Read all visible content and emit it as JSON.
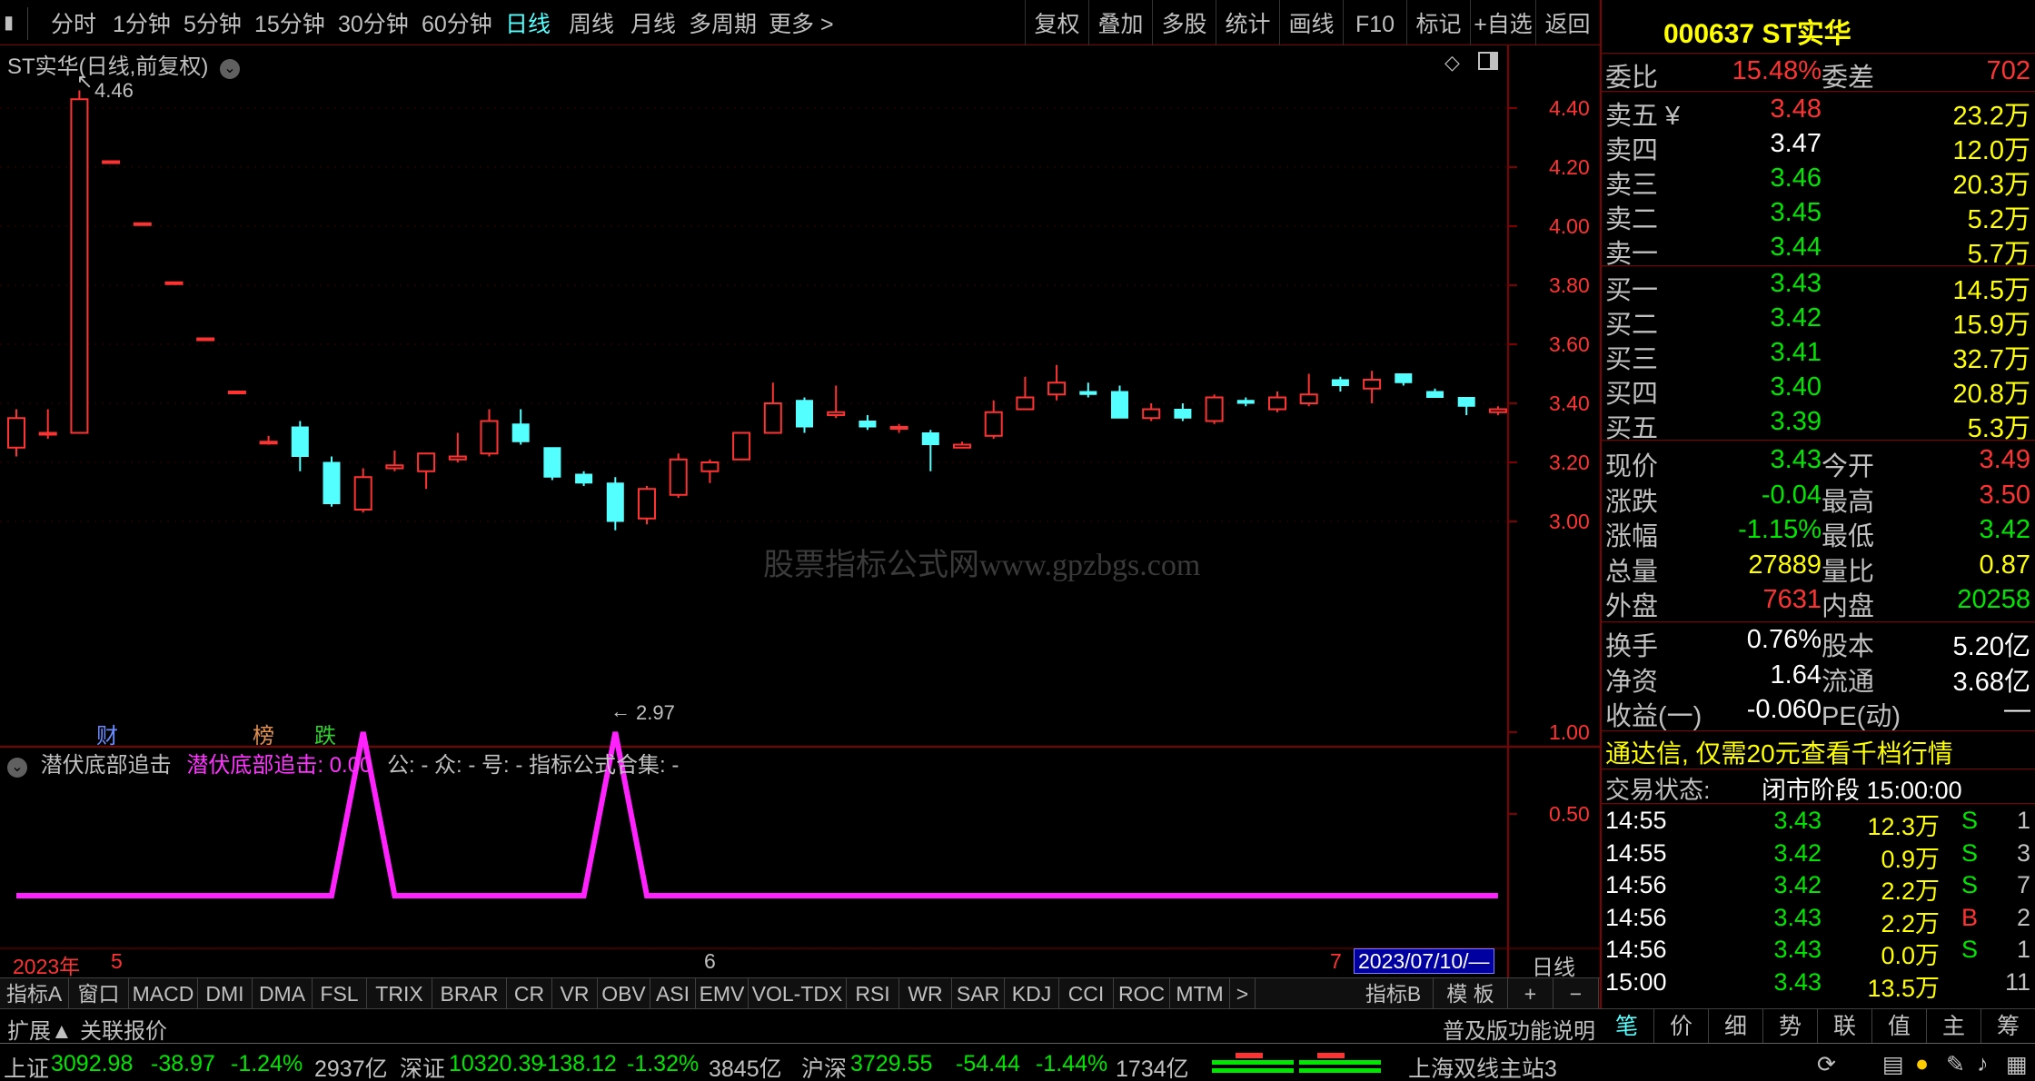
{
  "toolbar": {
    "periods": [
      "分时",
      "1分钟",
      "5分钟",
      "15分钟",
      "30分钟",
      "60分钟",
      "日线",
      "周线",
      "月线",
      "多周期",
      "更多 >"
    ],
    "active_period": "日线",
    "actions": [
      "复权",
      "叠加",
      "多股",
      "统计",
      "画线",
      "F10",
      "标记",
      "+自选",
      "返回"
    ]
  },
  "chart": {
    "title": "ST实华(日线,前复权)",
    "high_label": "4.46",
    "low_label": "2.97",
    "watermark": "股票指标公式网www.gpzbgs.com",
    "y_ticks": [
      "4.40",
      "4.20",
      "4.00",
      "3.80",
      "3.60",
      "3.40",
      "3.20",
      "3.00"
    ],
    "badges": [
      {
        "text": "财",
        "color": "#2a5cff"
      },
      {
        "text": "榜",
        "color": "#d07030"
      },
      {
        "text": "跌",
        "color": "#00c000"
      }
    ],
    "x_labels": {
      "year": "2023年",
      "m5": "5",
      "m6": "6",
      "m7": "7",
      "cursor_date": "2023/07/10/—",
      "period": "日线"
    }
  },
  "indicator": {
    "name": "潜伏底部追击",
    "value_label": "潜伏底部追击: 0.00",
    "extra": "公: -  众: -  号: -  指标公式合集: -",
    "y_ticks": [
      "1.00",
      "0.50"
    ]
  },
  "chart_data": [
    {
      "type": "candlestick",
      "title": "ST实华(日线,前复权)",
      "ylim": [
        2.9,
        4.6
      ],
      "candles": [
        {
          "o": 3.25,
          "h": 3.38,
          "l": 3.22,
          "c": 3.35
        },
        {
          "o": 3.3,
          "h": 3.38,
          "l": 3.28,
          "c": 3.3
        },
        {
          "o": 3.3,
          "h": 4.46,
          "l": 3.3,
          "c": 4.43
        },
        {
          "o": 4.22,
          "h": 4.22,
          "l": 4.22,
          "c": 4.22
        },
        {
          "o": 4.01,
          "h": 4.01,
          "l": 4.01,
          "c": 4.01
        },
        {
          "o": 3.81,
          "h": 3.81,
          "l": 3.81,
          "c": 3.81
        },
        {
          "o": 3.62,
          "h": 3.62,
          "l": 3.62,
          "c": 3.62
        },
        {
          "o": 3.44,
          "h": 3.44,
          "l": 3.44,
          "c": 3.44
        },
        {
          "o": 3.27,
          "h": 3.29,
          "l": 3.26,
          "c": 3.27
        },
        {
          "o": 3.32,
          "h": 3.34,
          "l": 3.17,
          "c": 3.22
        },
        {
          "o": 3.2,
          "h": 3.22,
          "l": 3.05,
          "c": 3.06
        },
        {
          "o": 3.04,
          "h": 3.18,
          "l": 3.03,
          "c": 3.15
        },
        {
          "o": 3.18,
          "h": 3.24,
          "l": 3.17,
          "c": 3.19
        },
        {
          "o": 3.17,
          "h": 3.23,
          "l": 3.11,
          "c": 3.23
        },
        {
          "o": 3.21,
          "h": 3.3,
          "l": 3.2,
          "c": 3.22
        },
        {
          "o": 3.23,
          "h": 3.38,
          "l": 3.22,
          "c": 3.34
        },
        {
          "o": 3.33,
          "h": 3.38,
          "l": 3.26,
          "c": 3.27
        },
        {
          "o": 3.25,
          "h": 3.25,
          "l": 3.14,
          "c": 3.15
        },
        {
          "o": 3.16,
          "h": 3.17,
          "l": 3.12,
          "c": 3.13
        },
        {
          "o": 3.13,
          "h": 3.15,
          "l": 2.97,
          "c": 3.0
        },
        {
          "o": 3.01,
          "h": 3.12,
          "l": 2.99,
          "c": 3.11
        },
        {
          "o": 3.09,
          "h": 3.23,
          "l": 3.08,
          "c": 3.21
        },
        {
          "o": 3.17,
          "h": 3.21,
          "l": 3.13,
          "c": 3.2
        },
        {
          "o": 3.21,
          "h": 3.3,
          "l": 3.21,
          "c": 3.3
        },
        {
          "o": 3.3,
          "h": 3.47,
          "l": 3.3,
          "c": 3.4
        },
        {
          "o": 3.41,
          "h": 3.42,
          "l": 3.3,
          "c": 3.32
        },
        {
          "o": 3.36,
          "h": 3.46,
          "l": 3.35,
          "c": 3.37
        },
        {
          "o": 3.34,
          "h": 3.36,
          "l": 3.31,
          "c": 3.32
        },
        {
          "o": 3.32,
          "h": 3.33,
          "l": 3.3,
          "c": 3.32
        },
        {
          "o": 3.3,
          "h": 3.31,
          "l": 3.17,
          "c": 3.26
        },
        {
          "o": 3.25,
          "h": 3.27,
          "l": 3.25,
          "c": 3.26
        },
        {
          "o": 3.29,
          "h": 3.41,
          "l": 3.28,
          "c": 3.37
        },
        {
          "o": 3.38,
          "h": 3.49,
          "l": 3.38,
          "c": 3.42
        },
        {
          "o": 3.43,
          "h": 3.53,
          "l": 3.41,
          "c": 3.47
        },
        {
          "o": 3.44,
          "h": 3.47,
          "l": 3.42,
          "c": 3.43
        },
        {
          "o": 3.44,
          "h": 3.46,
          "l": 3.35,
          "c": 3.35
        },
        {
          "o": 3.35,
          "h": 3.4,
          "l": 3.34,
          "c": 3.38
        },
        {
          "o": 3.38,
          "h": 3.4,
          "l": 3.34,
          "c": 3.35
        },
        {
          "o": 3.34,
          "h": 3.43,
          "l": 3.33,
          "c": 3.42
        },
        {
          "o": 3.41,
          "h": 3.42,
          "l": 3.39,
          "c": 3.4
        },
        {
          "o": 3.38,
          "h": 3.44,
          "l": 3.37,
          "c": 3.42
        },
        {
          "o": 3.4,
          "h": 3.5,
          "l": 3.39,
          "c": 3.43
        },
        {
          "o": 3.48,
          "h": 3.49,
          "l": 3.44,
          "c": 3.46
        },
        {
          "o": 3.45,
          "h": 3.51,
          "l": 3.4,
          "c": 3.48
        },
        {
          "o": 3.5,
          "h": 3.5,
          "l": 3.46,
          "c": 3.47
        },
        {
          "o": 3.44,
          "h": 3.45,
          "l": 3.42,
          "c": 3.42
        },
        {
          "o": 3.42,
          "h": 3.42,
          "l": 3.36,
          "c": 3.39
        },
        {
          "o": 3.37,
          "h": 3.39,
          "l": 3.36,
          "c": 3.38
        }
      ]
    },
    {
      "type": "line",
      "title": "潜伏底部追击",
      "ylim": [
        0,
        1.2
      ],
      "series": [
        {
          "name": "潜伏底部追击",
          "values": [
            0,
            0,
            0,
            0,
            0,
            0,
            0,
            0,
            0,
            0,
            0,
            1,
            0,
            0,
            0,
            0,
            0,
            0,
            0,
            1,
            0,
            0,
            0,
            0,
            0,
            0,
            0,
            0,
            0,
            0,
            0,
            0,
            0,
            0,
            0,
            0,
            0,
            0,
            0,
            0,
            0,
            0,
            0,
            0,
            0,
            0,
            0,
            0
          ]
        }
      ]
    }
  ],
  "quote": {
    "code_name": "000637 ST实华",
    "weibi_label": "委比",
    "weibi_value": "15.48%",
    "weicha_label": "委差",
    "weicha_value": "702",
    "sell": [
      {
        "label": "卖五",
        "mark": "¥",
        "price": "3.48",
        "vol": "23.2万",
        "color": "#ff3232"
      },
      {
        "label": "卖四",
        "mark": "",
        "price": "3.47",
        "vol": "12.0万",
        "color": "#ffffff"
      },
      {
        "label": "卖三",
        "mark": "",
        "price": "3.46",
        "vol": "20.3万",
        "color": "#00e600"
      },
      {
        "label": "卖二",
        "mark": "",
        "price": "3.45",
        "vol": "5.2万",
        "color": "#00e600"
      },
      {
        "label": "卖一",
        "mark": "",
        "price": "3.44",
        "vol": "5.7万",
        "color": "#00e600"
      }
    ],
    "buy": [
      {
        "label": "买一",
        "price": "3.43",
        "vol": "14.5万"
      },
      {
        "label": "买二",
        "price": "3.42",
        "vol": "15.9万"
      },
      {
        "label": "买三",
        "price": "3.41",
        "vol": "32.7万"
      },
      {
        "label": "买四",
        "price": "3.40",
        "vol": "20.8万"
      },
      {
        "label": "买五",
        "price": "3.39",
        "vol": "5.3万"
      }
    ],
    "stats": [
      {
        "l1": "现价",
        "v1": "3.43",
        "c1": "#00e600",
        "l2": "今开",
        "v2": "3.49",
        "c2": "#ff3232"
      },
      {
        "l1": "涨跌",
        "v1": "-0.04",
        "c1": "#00e600",
        "l2": "最高",
        "v2": "3.50",
        "c2": "#ff3232"
      },
      {
        "l1": "涨幅",
        "v1": "-1.15%",
        "c1": "#00e600",
        "l2": "最低",
        "v2": "3.42",
        "c2": "#00e600"
      },
      {
        "l1": "总量",
        "v1": "27889",
        "c1": "#ffff00",
        "l2": "量比",
        "v2": "0.87",
        "c2": "#ffff00"
      },
      {
        "l1": "外盘",
        "v1": "7631",
        "c1": "#ff3232",
        "l2": "内盘",
        "v2": "20258",
        "c2": "#00e600"
      }
    ],
    "stats2": [
      {
        "l1": "换手",
        "v1": "0.76%",
        "l2": "股本",
        "v2": "5.20亿"
      },
      {
        "l1": "净资",
        "v1": "1.64",
        "l2": "流通",
        "v2": "3.68亿"
      },
      {
        "l1": "收益(一)",
        "v1": "-0.060",
        "l2": "PE(动)",
        "v2": "—"
      }
    ],
    "ad": "通达信, 仅需20元查看千档行情",
    "trade_status_label": "交易状态:",
    "trade_status": "闭市阶段 15:00:00",
    "ticks": [
      {
        "time": "14:55",
        "price": "3.43",
        "vol": "12.3万",
        "bs": "S",
        "n": "1"
      },
      {
        "time": "14:55",
        "price": "3.42",
        "vol": "0.9万",
        "bs": "S",
        "n": "3"
      },
      {
        "time": "14:56",
        "price": "3.42",
        "vol": "2.2万",
        "bs": "S",
        "n": "7"
      },
      {
        "time": "14:56",
        "price": "3.43",
        "vol": "2.2万",
        "bs": "B",
        "n": "2"
      },
      {
        "time": "14:56",
        "price": "3.43",
        "vol": "0.0万",
        "bs": "S",
        "n": "1"
      },
      {
        "time": "15:00",
        "price": "3.43",
        "vol": "13.5万",
        "bs": "",
        "n": "11"
      }
    ],
    "tabs": [
      "笔",
      "价",
      "细",
      "势",
      "联",
      "值",
      "主",
      "筹"
    ]
  },
  "indicator_tabs": [
    "指标A",
    "窗口",
    "MACD",
    "DMI",
    "DMA",
    "FSL",
    "TRIX",
    "BRAR",
    "CR",
    "VR",
    "OBV",
    "ASI",
    "EMV",
    "VOL-TDX",
    "RSI",
    "WR",
    "SAR",
    "KDJ",
    "CCI",
    "ROC",
    "MTM",
    ">"
  ],
  "indicator_tabs_right": [
    "指标B",
    "模 板",
    "+",
    "−"
  ],
  "ext_bar": {
    "left1": "扩展▲",
    "left2": "关联报价",
    "right": "普及版功能说明"
  },
  "status": {
    "sh": "上证",
    "sh_val": "3092.98",
    "sh_chg": "-38.97",
    "sh_pct": "-1.24%",
    "sh_amt": "2937亿",
    "sz": "深证",
    "sz_val": "10320.39",
    "sz_chg": "-138.12",
    "sz_pct": "-1.32%",
    "sz_amt": "3845亿",
    "hs": "沪深",
    "hs_val": "3729.55",
    "hs_chg": "-54.44",
    "hs_pct": "-1.44%",
    "hs_amt": "1734亿",
    "server": "上海双线主站3"
  }
}
